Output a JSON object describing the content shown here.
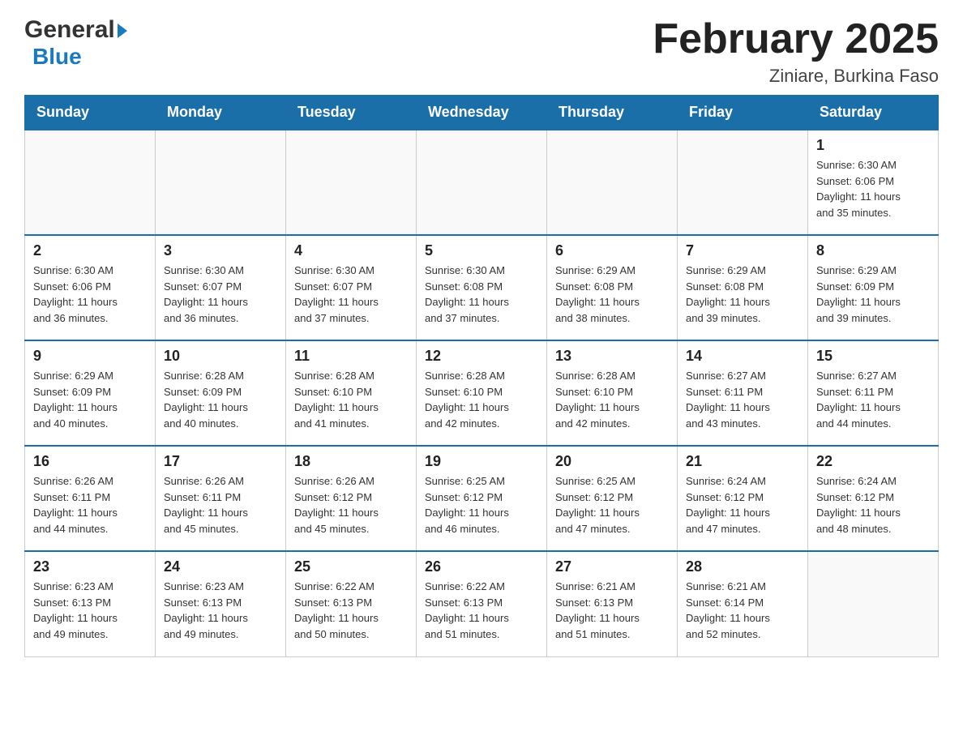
{
  "header": {
    "logo_line1": "General",
    "logo_triangle": "▶",
    "logo_line2": "Blue",
    "title": "February 2025",
    "subtitle": "Ziniare, Burkina Faso"
  },
  "days_of_week": [
    "Sunday",
    "Monday",
    "Tuesday",
    "Wednesday",
    "Thursday",
    "Friday",
    "Saturday"
  ],
  "weeks": [
    {
      "days": [
        {
          "number": "",
          "info": ""
        },
        {
          "number": "",
          "info": ""
        },
        {
          "number": "",
          "info": ""
        },
        {
          "number": "",
          "info": ""
        },
        {
          "number": "",
          "info": ""
        },
        {
          "number": "",
          "info": ""
        },
        {
          "number": "1",
          "info": "Sunrise: 6:30 AM\nSunset: 6:06 PM\nDaylight: 11 hours\nand 35 minutes."
        }
      ]
    },
    {
      "days": [
        {
          "number": "2",
          "info": "Sunrise: 6:30 AM\nSunset: 6:06 PM\nDaylight: 11 hours\nand 36 minutes."
        },
        {
          "number": "3",
          "info": "Sunrise: 6:30 AM\nSunset: 6:07 PM\nDaylight: 11 hours\nand 36 minutes."
        },
        {
          "number": "4",
          "info": "Sunrise: 6:30 AM\nSunset: 6:07 PM\nDaylight: 11 hours\nand 37 minutes."
        },
        {
          "number": "5",
          "info": "Sunrise: 6:30 AM\nSunset: 6:08 PM\nDaylight: 11 hours\nand 37 minutes."
        },
        {
          "number": "6",
          "info": "Sunrise: 6:29 AM\nSunset: 6:08 PM\nDaylight: 11 hours\nand 38 minutes."
        },
        {
          "number": "7",
          "info": "Sunrise: 6:29 AM\nSunset: 6:08 PM\nDaylight: 11 hours\nand 39 minutes."
        },
        {
          "number": "8",
          "info": "Sunrise: 6:29 AM\nSunset: 6:09 PM\nDaylight: 11 hours\nand 39 minutes."
        }
      ]
    },
    {
      "days": [
        {
          "number": "9",
          "info": "Sunrise: 6:29 AM\nSunset: 6:09 PM\nDaylight: 11 hours\nand 40 minutes."
        },
        {
          "number": "10",
          "info": "Sunrise: 6:28 AM\nSunset: 6:09 PM\nDaylight: 11 hours\nand 40 minutes."
        },
        {
          "number": "11",
          "info": "Sunrise: 6:28 AM\nSunset: 6:10 PM\nDaylight: 11 hours\nand 41 minutes."
        },
        {
          "number": "12",
          "info": "Sunrise: 6:28 AM\nSunset: 6:10 PM\nDaylight: 11 hours\nand 42 minutes."
        },
        {
          "number": "13",
          "info": "Sunrise: 6:28 AM\nSunset: 6:10 PM\nDaylight: 11 hours\nand 42 minutes."
        },
        {
          "number": "14",
          "info": "Sunrise: 6:27 AM\nSunset: 6:11 PM\nDaylight: 11 hours\nand 43 minutes."
        },
        {
          "number": "15",
          "info": "Sunrise: 6:27 AM\nSunset: 6:11 PM\nDaylight: 11 hours\nand 44 minutes."
        }
      ]
    },
    {
      "days": [
        {
          "number": "16",
          "info": "Sunrise: 6:26 AM\nSunset: 6:11 PM\nDaylight: 11 hours\nand 44 minutes."
        },
        {
          "number": "17",
          "info": "Sunrise: 6:26 AM\nSunset: 6:11 PM\nDaylight: 11 hours\nand 45 minutes."
        },
        {
          "number": "18",
          "info": "Sunrise: 6:26 AM\nSunset: 6:12 PM\nDaylight: 11 hours\nand 45 minutes."
        },
        {
          "number": "19",
          "info": "Sunrise: 6:25 AM\nSunset: 6:12 PM\nDaylight: 11 hours\nand 46 minutes."
        },
        {
          "number": "20",
          "info": "Sunrise: 6:25 AM\nSunset: 6:12 PM\nDaylight: 11 hours\nand 47 minutes."
        },
        {
          "number": "21",
          "info": "Sunrise: 6:24 AM\nSunset: 6:12 PM\nDaylight: 11 hours\nand 47 minutes."
        },
        {
          "number": "22",
          "info": "Sunrise: 6:24 AM\nSunset: 6:12 PM\nDaylight: 11 hours\nand 48 minutes."
        }
      ]
    },
    {
      "days": [
        {
          "number": "23",
          "info": "Sunrise: 6:23 AM\nSunset: 6:13 PM\nDaylight: 11 hours\nand 49 minutes."
        },
        {
          "number": "24",
          "info": "Sunrise: 6:23 AM\nSunset: 6:13 PM\nDaylight: 11 hours\nand 49 minutes."
        },
        {
          "number": "25",
          "info": "Sunrise: 6:22 AM\nSunset: 6:13 PM\nDaylight: 11 hours\nand 50 minutes."
        },
        {
          "number": "26",
          "info": "Sunrise: 6:22 AM\nSunset: 6:13 PM\nDaylight: 11 hours\nand 51 minutes."
        },
        {
          "number": "27",
          "info": "Sunrise: 6:21 AM\nSunset: 6:13 PM\nDaylight: 11 hours\nand 51 minutes."
        },
        {
          "number": "28",
          "info": "Sunrise: 6:21 AM\nSunset: 6:14 PM\nDaylight: 11 hours\nand 52 minutes."
        },
        {
          "number": "",
          "info": ""
        }
      ]
    }
  ]
}
